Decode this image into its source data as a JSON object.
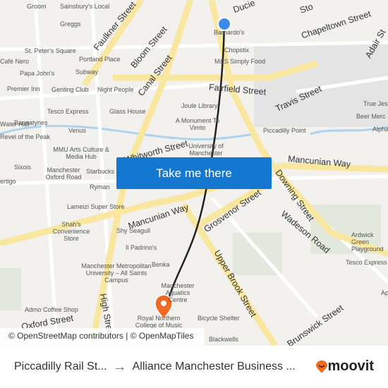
{
  "map": {
    "streets": [
      "Ducie",
      "Faulkner Street",
      "Bloom Street",
      "Canal Street",
      "Fairfield Street",
      "Travis Street",
      "Chapeltown Street",
      "Adair St",
      "Mancunian Way",
      "Mancunian Way",
      "Grosvenor Street",
      "Upper Brook Street",
      "Downing Street",
      "Wadeson Road",
      "Whitworth Street",
      "Brunswick Street",
      "High Street",
      "Oxford Street",
      "Sto"
    ],
    "places": [
      "Groom",
      "Sainsbury's Local",
      "Greggs",
      "St. Peter's Square",
      "Portland Place",
      "Café Nero",
      "Papa John's",
      "Subway",
      "Premier Inn",
      "Genting Club",
      "Night People",
      "Tesco Express",
      "Glass House",
      "Joule Library",
      "Barnardo's",
      "Chopstix",
      "M&S Simply Food",
      "A Monument To Vimto",
      "University of Manchester",
      "Water Hall",
      "Bannatynes",
      "Venus",
      "Revel of the Peak",
      "MMU Arts Culture & Media Hub",
      "Manchester Oxford Road",
      "Starbucks",
      "Sixois",
      "Ryman",
      "Lameizi Super Store",
      "Shah's Convenience Store",
      "Shy Seagull",
      "Il Padrino's",
      "Manchester Metropolitan University – All Saints Campus",
      "Benka",
      "Manchester Aquatics Centre",
      "Admo Coffee Shop",
      "Royal Northern College of Music",
      "Bicycle Shelter",
      "Blackwells",
      "Piccadilly Point",
      "True Jesus",
      "Beer Merc",
      "Alpha",
      "Ardwick Green Playground",
      "Tesco Express",
      "Ap",
      "ertigo"
    ]
  },
  "cta": {
    "label": "Take me there"
  },
  "attribution": "© OpenStreetMap contributors | © OpenMapTiles",
  "footer": {
    "origin": "Piccadilly Rail St...",
    "arrow": "→",
    "destination": "Alliance Manchester Business ...",
    "brand": "moovit"
  },
  "colors": {
    "accent": "#1478d1",
    "origin_dot": "#3b8beb",
    "destination_pin": "#f26a21",
    "route": "#222222",
    "brand": "#f26a21"
  }
}
